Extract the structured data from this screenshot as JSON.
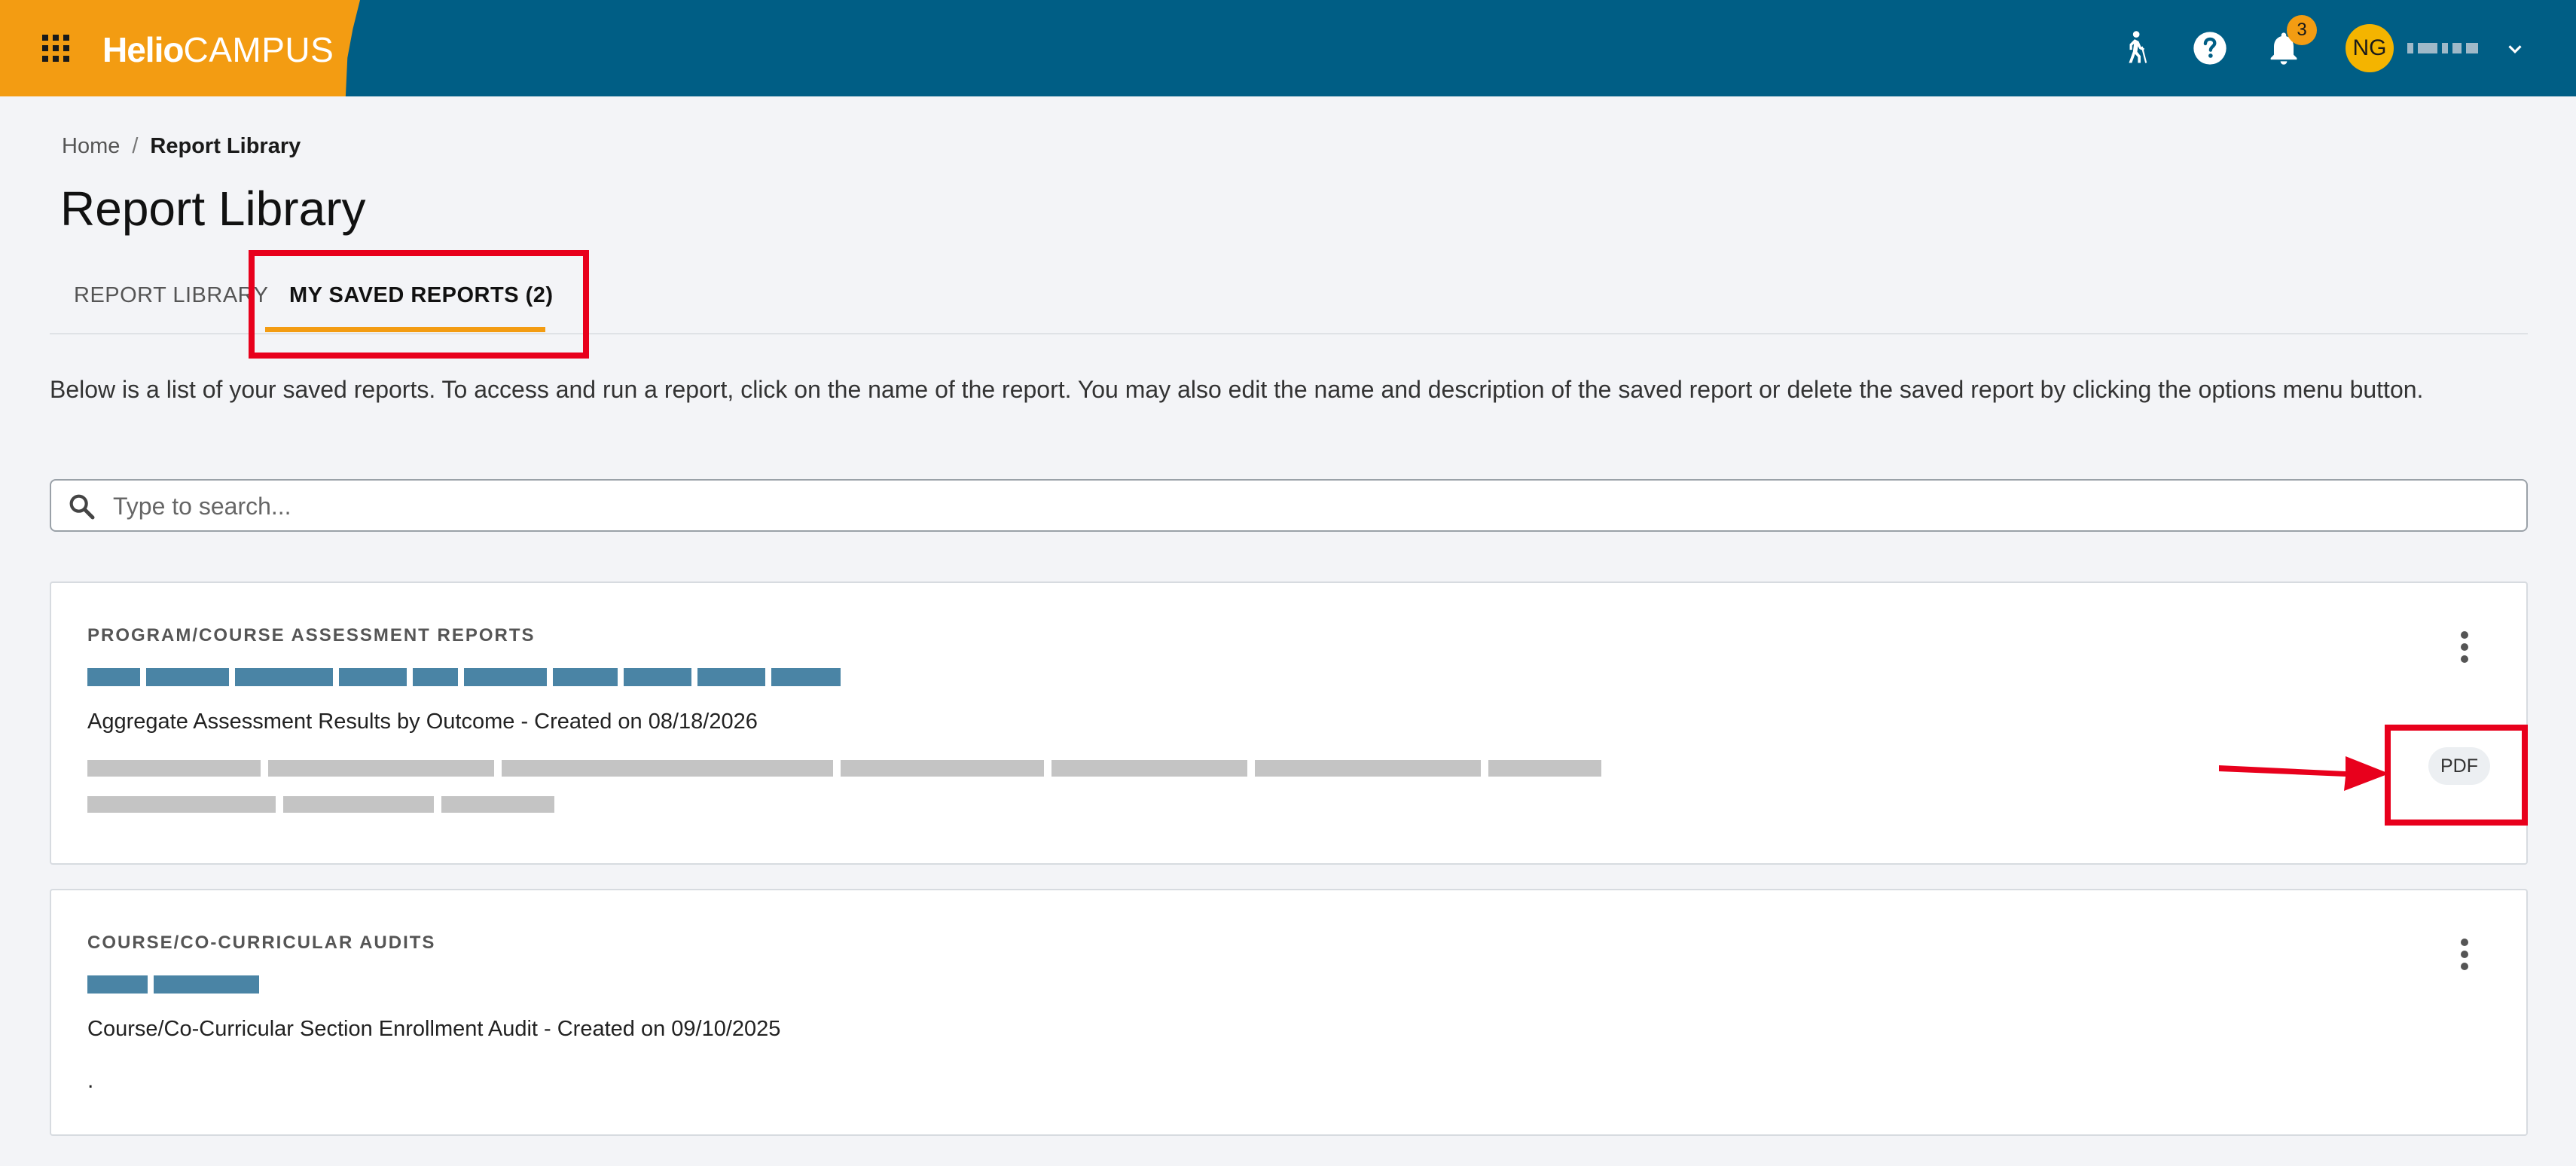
{
  "brand": {
    "name_bold": "Helio",
    "name_light": "CAMPUS"
  },
  "header": {
    "notification_count": "3",
    "avatar_initials": "NG",
    "colors": {
      "bar": "#005e85",
      "brand": "#f39c12",
      "avatar": "#f4b400"
    },
    "icons": [
      "apps-grid-icon",
      "walking-person-icon",
      "help-icon",
      "bell-icon",
      "chevron-down-icon"
    ]
  },
  "breadcrumb": {
    "home": "Home",
    "separator": "/",
    "current": "Report Library"
  },
  "page": {
    "title": "Report Library"
  },
  "tabs": [
    {
      "label": "REPORT LIBRARY",
      "active": false
    },
    {
      "label": "MY SAVED REPORTS (2)",
      "active": true
    }
  ],
  "description": "Below is a list of your saved reports. To access and run a report, click on the name of the report. You may also edit the name and description of the saved report or delete the saved report by clicking the options menu button.",
  "search": {
    "placeholder": "Type to search..."
  },
  "reports": [
    {
      "category": "PROGRAM/COURSE ASSESSMENT REPORTS",
      "subtitle": "Aggregate Assessment Results by Outcome - Created on 08/18/2026",
      "format": "PDF"
    },
    {
      "category": "COURSE/CO-CURRICULAR AUDITS",
      "subtitle": "Course/Co-Curricular Section Enrollment Audit - Created on 09/10/2025",
      "description": "."
    }
  ],
  "annotations": {
    "highlight_color": "#e8001c"
  }
}
